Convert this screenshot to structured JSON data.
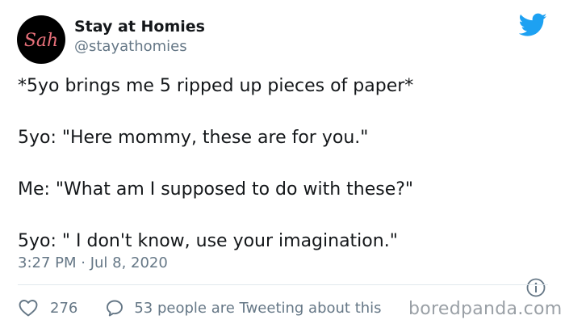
{
  "author": {
    "display_name": "Stay at Homies",
    "handle": "@stayathomies",
    "avatar_text": "Sah"
  },
  "tweet": {
    "lines": [
      "*5yo brings me 5 ripped up pieces of paper*",
      "5yo: \"Here mommy, these are for you.\"",
      "Me: \"What am I supposed to do with these?\"",
      "5yo: \" I don't know, use your imagination.\""
    ],
    "timestamp": "3:27 PM · Jul 8, 2020"
  },
  "actions": {
    "like_count": "276",
    "conversation_text": "53 people are Tweeting about this"
  },
  "watermark": "boredpanda.com",
  "icons": {
    "brand": "twitter-bird-icon",
    "info": "info-icon",
    "like": "heart-icon",
    "reply": "speech-bubble-icon"
  },
  "colors": {
    "twitter_blue": "#1da1f2",
    "avatar_bg": "#000000",
    "avatar_text": "#e8707a",
    "secondary_text": "#657786"
  }
}
